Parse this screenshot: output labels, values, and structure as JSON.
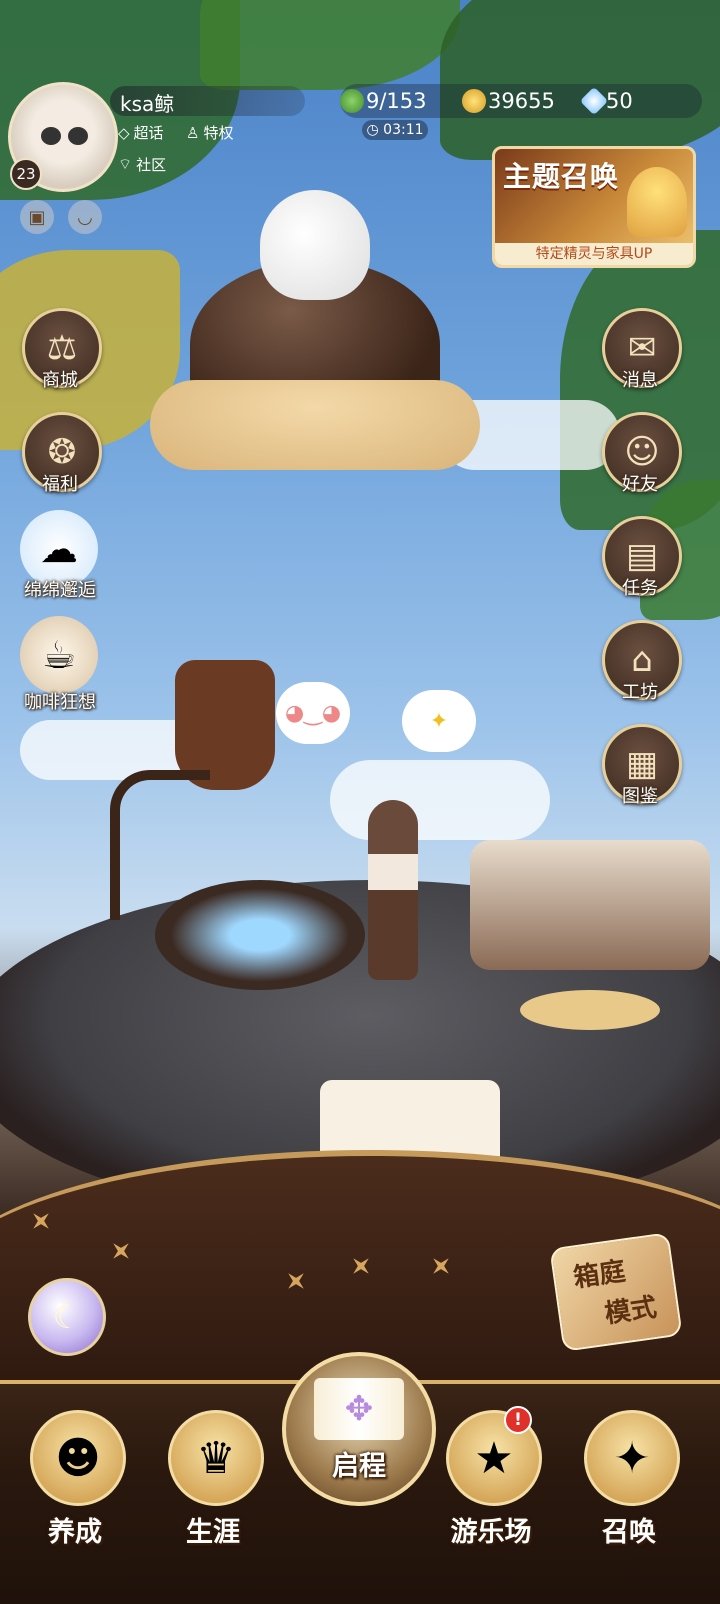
{
  "player": {
    "name": "ksa鲸",
    "level": "23",
    "tags": {
      "supertopic": "超话",
      "privilege": "特权",
      "community": "社区"
    }
  },
  "resources": {
    "energy": "9/153",
    "coins": "39655",
    "diamonds": "50",
    "timer": "03:11"
  },
  "banner": {
    "title": "主题召唤",
    "subtitle": "特定精灵与家具UP"
  },
  "left_menu": [
    {
      "label": "商城",
      "icon": "scales-icon"
    },
    {
      "label": "福利",
      "icon": "gift-globe-icon"
    },
    {
      "label": "绵绵邂逅",
      "icon": "cinnamoroll-icon"
    },
    {
      "label": "咖啡狂想",
      "icon": "coffee-cup-icon"
    }
  ],
  "right_menu": [
    {
      "label": "消息",
      "icon": "envelope-icon"
    },
    {
      "label": "好友",
      "icon": "friends-icon"
    },
    {
      "label": "任务",
      "icon": "clipboard-icon"
    },
    {
      "label": "工坊",
      "icon": "workshop-icon"
    },
    {
      "label": "图鉴",
      "icon": "album-icon"
    }
  ],
  "box_mode": {
    "line1": "箱庭",
    "line2": "模式"
  },
  "bottom_nav": [
    {
      "label": "养成",
      "icon": "character-icon"
    },
    {
      "label": "生涯",
      "icon": "crown-icon"
    },
    {
      "label": "启程",
      "icon": "storybook-icon"
    },
    {
      "label": "游乐场",
      "icon": "star-badge-icon",
      "badge": "!"
    },
    {
      "label": "召唤",
      "icon": "summon-card-icon"
    }
  ],
  "colors": {
    "accent_gold": "#e7cf9a",
    "nav_bg": "#2a180e",
    "badge_red": "#e0302a"
  }
}
